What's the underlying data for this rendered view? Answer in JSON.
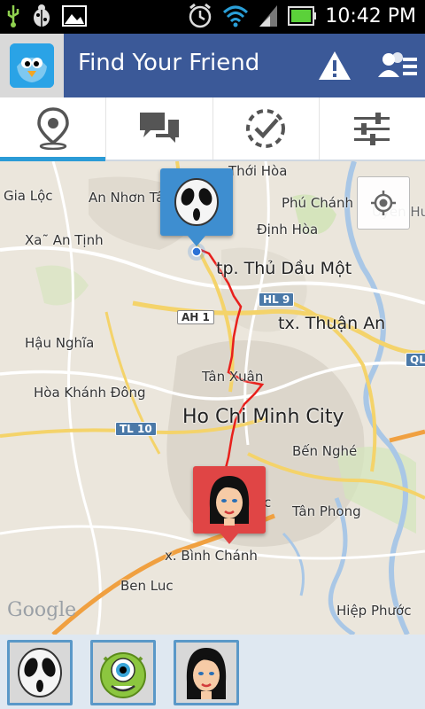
{
  "status_bar": {
    "time": "10:42 PM",
    "icons": [
      "usb-icon",
      "debug-bug-icon",
      "image-icon",
      "alarm-clock-icon",
      "wifi-icon",
      "signal-icon",
      "battery-icon"
    ]
  },
  "action_bar": {
    "title": "Find Your Friend",
    "buttons": [
      "warning-icon",
      "friends-list-icon"
    ],
    "background": "#3b5998"
  },
  "tabs": [
    {
      "name": "map",
      "icon": "location-pin-icon",
      "active": true
    },
    {
      "name": "chat",
      "icon": "chat-bubbles-icon",
      "active": false
    },
    {
      "name": "check-in",
      "icon": "dashed-check-icon",
      "active": false
    },
    {
      "name": "settings",
      "icon": "sliders-icon",
      "active": false
    }
  ],
  "map": {
    "labels": {
      "thoi_hoa": "Thới Hòa",
      "gia_loc": "Gia Lộc",
      "an_nhon_tay": "An Nhơn Tâ",
      "phu_chanh": "Phú Chánh",
      "dinh_hoa": "Định Hòa",
      "xa_an_tinh": "Xa˜ An Tịnh",
      "tp_thu_dau_mot": "tp. Thủ Dầu Một",
      "uyen_hung": "Uyen Hu",
      "ah1": "AH 1",
      "hl9": "HL 9",
      "tx_thuan_an": "tx. Thuận An",
      "hau_nghia": "Hậu Nghĩa",
      "ql": "QL",
      "tan_xuan": "Tân Xuân",
      "hoa_khanh_dong": "Hòa Khánh Đông",
      "ho_chi_minh_city": "Ho Chi Minh City",
      "tl10": "TL 10",
      "ben_nghe": "Bến Nghé",
      "tan_phong": "Tân Phong",
      "c": "c",
      "binh_chanh": "x. Bình Chánh",
      "ben_luc": "Ben Luc",
      "hiep_phuoc": "Hiệp Phước",
      "google": "Google"
    },
    "route_color": "#e8201c",
    "pins": [
      {
        "name": "ghost-friend",
        "color": "#3e8ed0",
        "avatar": "scream-mask-avatar"
      },
      {
        "name": "girl-friend",
        "color": "#e04545",
        "avatar": "girl-avatar"
      }
    ]
  },
  "friends": [
    {
      "avatar": "scream-mask-avatar"
    },
    {
      "avatar": "green-monster-avatar"
    },
    {
      "avatar": "girl-avatar"
    }
  ]
}
